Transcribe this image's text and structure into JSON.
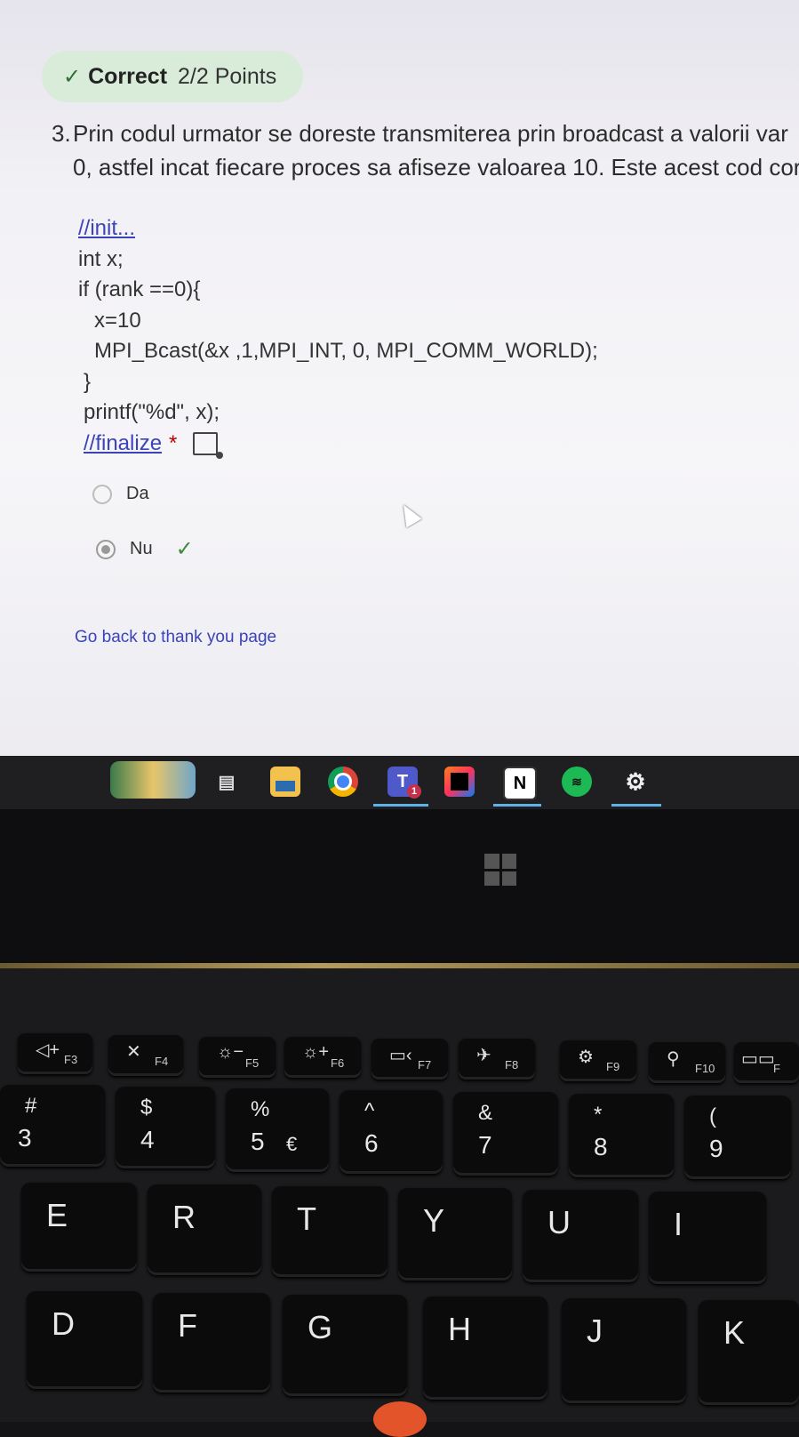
{
  "result": {
    "status": "Correct",
    "points": "2/2 Points"
  },
  "question": {
    "number": "3.",
    "line1": "Prin codul urmator se doreste transmiterea prin broadcast a valorii var",
    "line2": "0, astfel incat fiecare proces sa afiseze valoarea 10. Este acest cod core"
  },
  "code": {
    "init": "//init...",
    "l1": "int x;",
    "l2": "if (rank ==0){",
    "l3": "x=10",
    "l4": "MPI_Bcast(&x ,1,MPI_INT, 0, MPI_COMM_WORLD);",
    "l5": "}",
    "l6": "printf(\"%d\", x);",
    "finalize": "//finalize",
    "required": "*"
  },
  "options": [
    {
      "label": "Da",
      "selected": false
    },
    {
      "label": "Nu",
      "selected": true,
      "correct": true
    }
  ],
  "back_link": "Go back to thank you page",
  "taskbar": {
    "icons": [
      "copilot-icon",
      "task-view-icon",
      "file-explorer-icon",
      "chrome-icon",
      "teams-icon",
      "intellij-icon",
      "notion-icon",
      "spotify-icon",
      "settings-icon"
    ],
    "teams_badge": "1",
    "notion_glyph": "N"
  },
  "keyboard": {
    "fkeys": [
      {
        "sym": "◁+",
        "label": "F3"
      },
      {
        "sym": "✕",
        "label": "F4"
      },
      {
        "sym": "☼−",
        "label": "F5"
      },
      {
        "sym": "☼+",
        "label": "F6"
      },
      {
        "sym": "▭‹",
        "label": "F7"
      },
      {
        "sym": "✈",
        "label": "F8"
      },
      {
        "sym": "⚙",
        "label": "F9"
      },
      {
        "sym": "⚲",
        "label": "F10"
      },
      {
        "sym": "▭▭",
        "label": "F"
      }
    ],
    "numkeys": [
      {
        "top": "#",
        "bot": "3",
        "alt": ""
      },
      {
        "top": "$",
        "bot": "4",
        "alt": ""
      },
      {
        "top": "%",
        "bot": "5",
        "alt": "€"
      },
      {
        "top": "^",
        "bot": "6",
        "alt": ""
      },
      {
        "top": "&",
        "bot": "7",
        "alt": ""
      },
      {
        "top": "*",
        "bot": "8",
        "alt": ""
      },
      {
        "top": "(",
        "bot": "9",
        "alt": ""
      }
    ],
    "row_qwerty": [
      "E",
      "R",
      "T",
      "Y",
      "U",
      "I"
    ],
    "row_home": [
      "D",
      "F",
      "G",
      "H",
      "J",
      "K"
    ]
  }
}
